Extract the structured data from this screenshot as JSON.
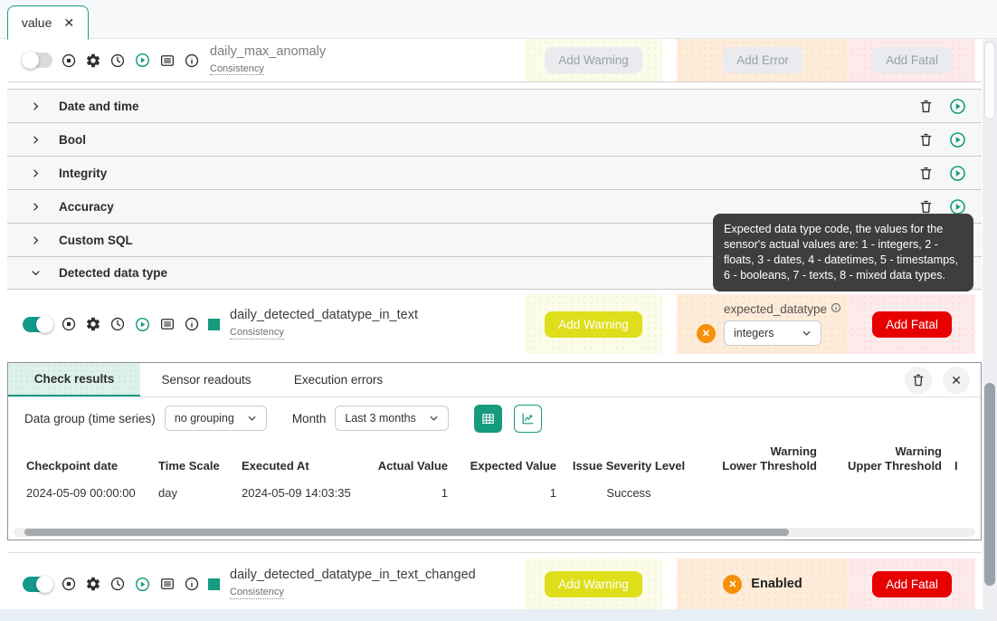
{
  "tab": {
    "label": "value",
    "close": "✕"
  },
  "colors": {
    "accent_teal": "#169b7f",
    "warning_yellow": "#dedf1a",
    "fatal_red": "#e60000",
    "orange_badge": "#f79009",
    "tooltip_bg": "#3e3e3e"
  },
  "row1": {
    "name": "daily_max_anomaly",
    "category": "Consistency",
    "warning_label": "Add Warning",
    "error_label": "Add Error",
    "fatal_label": "Add Fatal"
  },
  "sections": {
    "s1": "Date and time",
    "s2": "Bool",
    "s3": "Integrity",
    "s4": "Accuracy",
    "s5": "Custom SQL",
    "s6": "Detected data type"
  },
  "tooltip": {
    "text": "Expected data type code, the values for the sensor's actual values are: 1 - integers, 2 - floats, 3 - dates, 4 - datetimes, 5 - timestamps, 6 - booleans, 7 - texts, 8 - mixed data types."
  },
  "row2": {
    "name": "daily_detected_datatype_in_text",
    "category": "Consistency",
    "warning_label": "Add Warning",
    "fatal_label": "Add Fatal",
    "param_label": "expected_datatype",
    "param_value": "integers",
    "x_glyph": "✕"
  },
  "panel": {
    "tabs": {
      "t1": "Check results",
      "t2": "Sensor readouts",
      "t3": "Execution errors"
    },
    "filter": {
      "group_label": "Data group (time series)",
      "group_value": "no grouping",
      "month_label": "Month",
      "month_value": "Last 3 months"
    },
    "table": {
      "headers": {
        "h1": "Checkpoint date",
        "h2": "Time Scale",
        "h3": "Executed At",
        "h4": "Actual Value",
        "h5": "Expected Value",
        "h6": "Issue Severity Level",
        "h7a": "Warning",
        "h7b": "Lower Threshold",
        "h8a": "Warning",
        "h8b": "Upper Threshold",
        "h9": "I"
      },
      "row": {
        "c1": "2024-05-09 00:00:00",
        "c2": "day",
        "c3": "2024-05-09 14:03:35",
        "c4": "1",
        "c5": "1",
        "c6": "Success"
      }
    },
    "close_glyph": "✕"
  },
  "row3": {
    "name": "daily_detected_datatype_in_text_changed",
    "category": "Consistency",
    "warning_label": "Add Warning",
    "fatal_label": "Add Fatal",
    "status_label": "Enabled",
    "x_glyph": "✕"
  }
}
